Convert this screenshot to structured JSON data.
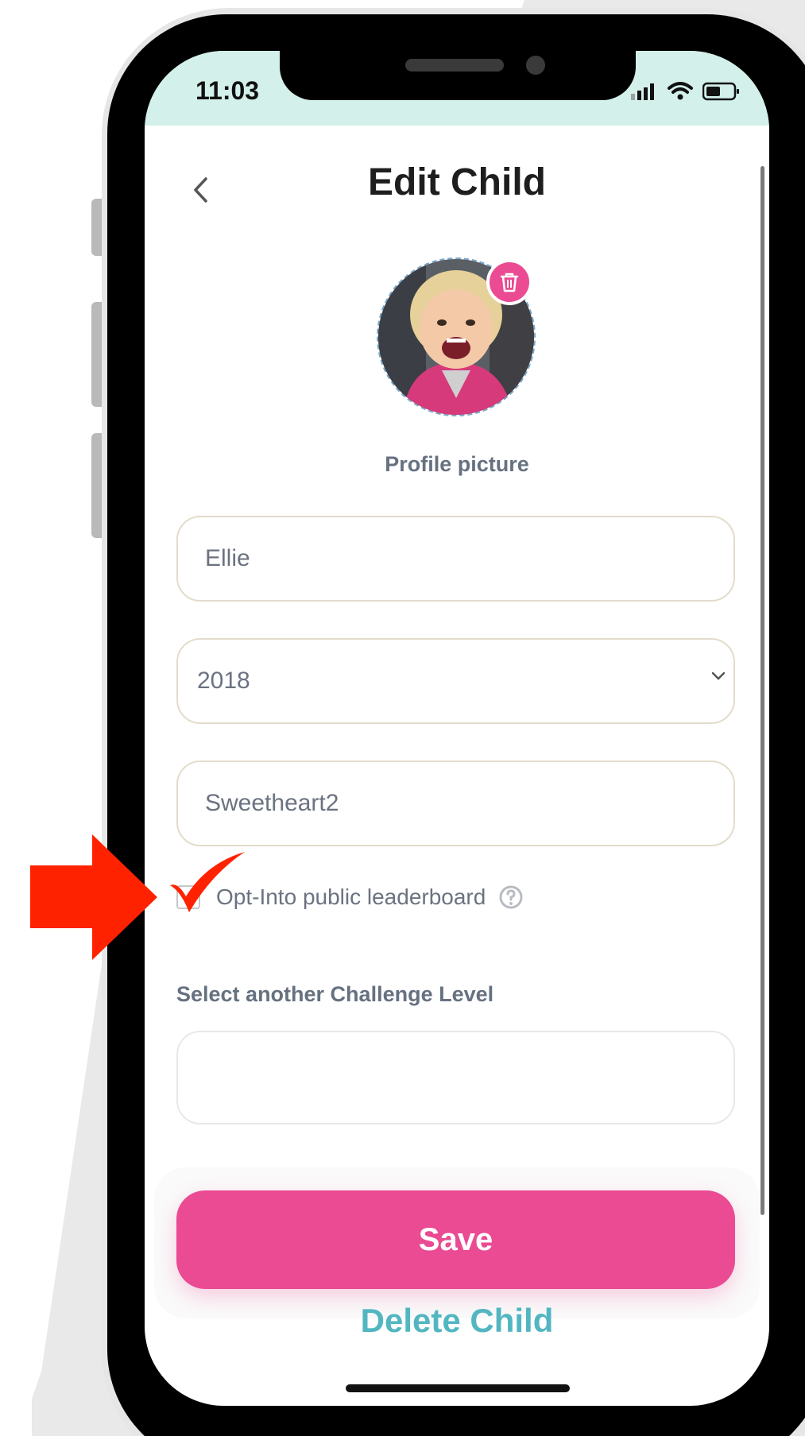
{
  "status_bar": {
    "time": "11:03"
  },
  "header": {
    "title": "Edit Child",
    "back_icon": "chevron-left-icon"
  },
  "profile": {
    "label": "Profile picture",
    "delete_icon": "trash-icon"
  },
  "form": {
    "name_value": "Ellie",
    "birth_year_value": "2018",
    "username_value": "Sweetheart2",
    "leaderboard_checkbox_label": "Opt-Into public leaderboard",
    "leaderboard_checked": false,
    "challenge_level_label": "Select another Challenge Level",
    "challenge_level_value": ""
  },
  "actions": {
    "save_label": "Save",
    "delete_label": "Delete Child"
  },
  "colors": {
    "accent_pink": "#ea4b93",
    "teal": "#52b6c1",
    "status_bar_bg": "#d3f0ea",
    "annotation_red": "#ff2200"
  }
}
